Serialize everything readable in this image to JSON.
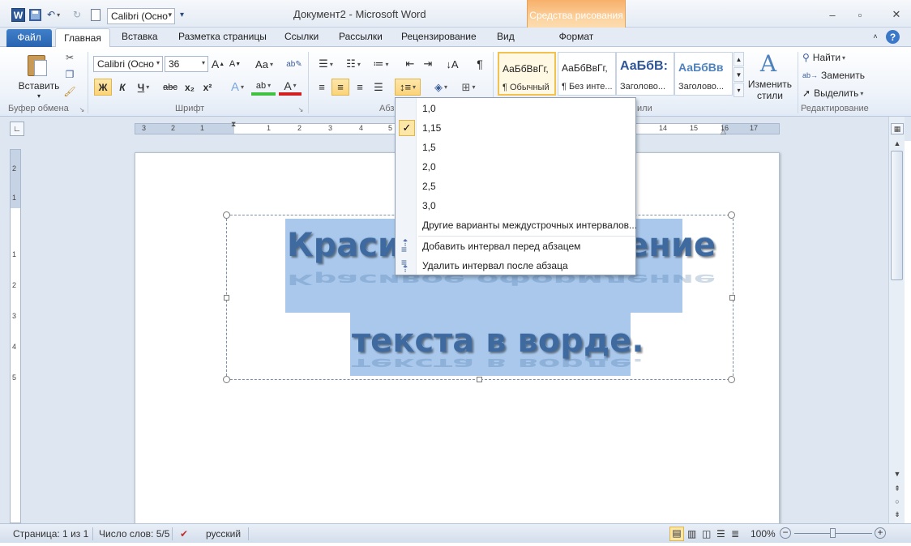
{
  "titlebar": {
    "app_icon": "W",
    "font_quick": "Calibri (Осно",
    "title": "Документ2 - Microsoft Word",
    "contextual_tab": "Средства рисования"
  },
  "tabs": [
    "Файл",
    "Главная",
    "Вставка",
    "Разметка страницы",
    "Ссылки",
    "Рассылки",
    "Рецензирование",
    "Вид",
    "Формат"
  ],
  "ribbon": {
    "clipboard": {
      "paste": "Вставить",
      "label": "Буфер обмена"
    },
    "font": {
      "name": "Calibri (Осно",
      "size": "36",
      "bold": "Ж",
      "italic": "К",
      "underline": "Ч",
      "strike": "abc",
      "sub": "x₂",
      "sup": "x²",
      "grow": "A",
      "shrink": "A",
      "case": "Aa",
      "label": "Шрифт"
    },
    "paragraph": {
      "label": "Абз",
      "pilcrow": "¶"
    },
    "styles": {
      "items": [
        {
          "preview": "АаБбВвГг,",
          "name": "¶ Обычный"
        },
        {
          "preview": "АаБбВвГг,",
          "name": "¶ Без инте..."
        },
        {
          "preview": "АаБбВ:",
          "name": "Заголово..."
        },
        {
          "preview": "АаБбВв",
          "name": "Заголово..."
        }
      ],
      "change": "Изменить стили",
      "label_tail": "или"
    },
    "editing": {
      "find": "Найти",
      "replace": "Заменить",
      "select": "Выделить",
      "label": "Редактирование"
    }
  },
  "ruler": {
    "h_numbers": [
      "3",
      "2",
      "1",
      "1",
      "2",
      "3",
      "4",
      "5",
      "14",
      "15",
      "16",
      "17"
    ],
    "v_numbers": [
      "2",
      "1",
      "1",
      "2",
      "3",
      "4",
      "5"
    ]
  },
  "document": {
    "line1": "Красивое оформление",
    "line2": "текста в ворде."
  },
  "spacing_menu": {
    "options": [
      "1,0",
      "1,15",
      "1,5",
      "2,0",
      "2,5",
      "3,0"
    ],
    "selected": "1,15",
    "more": "Другие варианты междустрочных интервалов...",
    "add_before": "Добавить интервал перед абзацем",
    "remove_after": "Удалить интервал после абзаца"
  },
  "statusbar": {
    "page": "Страница: 1 из 1",
    "words": "Число слов: 5/5",
    "language": "русский",
    "zoom": "100%"
  },
  "colors": {
    "accent": "#2a64b0",
    "highlight": "#a9c8ec",
    "contextual": "#f7b06a"
  }
}
